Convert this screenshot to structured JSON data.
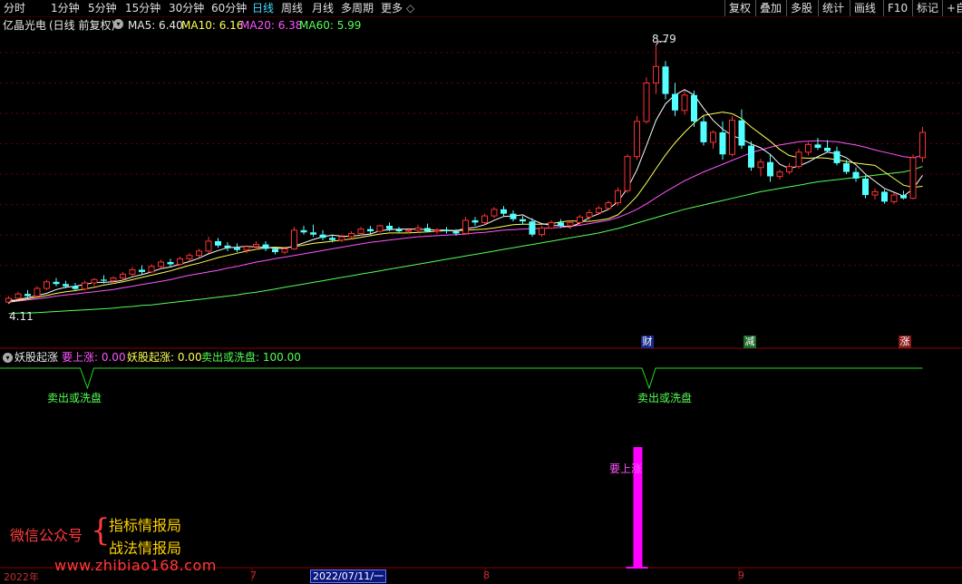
{
  "toolbar": {
    "periods": [
      "分时",
      "1分钟",
      "5分钟",
      "15分钟",
      "30分钟",
      "60分钟",
      "日线",
      "周线",
      "月线",
      "多周期",
      "更多"
    ],
    "active_period": "日线",
    "more_arrow": "◇",
    "right_items": [
      "复权",
      "叠加",
      "多股",
      "统计",
      "画线",
      "F10",
      "标记"
    ],
    "corner": "+自"
  },
  "main_header": {
    "stock_name": "亿晶光电",
    "mode": "(日线 前复权)",
    "ma5_label": "MA5: 6.40",
    "ma10_label": "MA10: 6.16",
    "ma20_label": "MA20: 6.38",
    "ma60_label": "MA60: 5.99"
  },
  "indicator_header": {
    "name": "妖股起涨",
    "l1": "要上涨: 0.00",
    "l2": "妖股起涨: 0.00",
    "l3": "卖出或洗盘: 100.00"
  },
  "annotations": {
    "high": "8.79",
    "low": "4.11",
    "sell1": "卖出或洗盘",
    "sell2": "卖出或洗盘",
    "rise": "要上涨"
  },
  "events": [
    "财",
    "减",
    "涨"
  ],
  "x_axis": {
    "labels": [
      "2022年",
      "7",
      "8",
      "9"
    ],
    "selected": "2022/07/11/一"
  },
  "watermark": {
    "left": "微信公众号",
    "brace": "{",
    "top": "指标情报局",
    "bottom": "战法情报局",
    "url": "www.zhibiao168.com"
  },
  "colors": {
    "up": "#ff3232",
    "down": "#54ffff",
    "ma5": "#ffffff",
    "ma10": "#ffff55",
    "ma20": "#ff55ff",
    "ma60": "#55ff55",
    "indicator_line": "#22dd22",
    "rise_bar": "#ff00ff",
    "grid": "#6a0000"
  },
  "chart_data": {
    "type": "candlestick",
    "ohlc": [
      [
        4.11,
        4.22,
        4.08,
        4.18
      ],
      [
        4.18,
        4.3,
        4.15,
        4.26
      ],
      [
        4.26,
        4.33,
        4.2,
        4.22
      ],
      [
        4.22,
        4.4,
        4.2,
        4.36
      ],
      [
        4.36,
        4.52,
        4.33,
        4.48
      ],
      [
        4.48,
        4.55,
        4.4,
        4.44
      ],
      [
        4.44,
        4.5,
        4.36,
        4.4
      ],
      [
        4.4,
        4.46,
        4.32,
        4.35
      ],
      [
        4.35,
        4.5,
        4.32,
        4.46
      ],
      [
        4.46,
        4.55,
        4.4,
        4.52
      ],
      [
        4.52,
        4.6,
        4.45,
        4.5
      ],
      [
        4.5,
        4.58,
        4.44,
        4.55
      ],
      [
        4.55,
        4.66,
        4.5,
        4.62
      ],
      [
        4.62,
        4.75,
        4.58,
        4.7
      ],
      [
        4.7,
        4.78,
        4.62,
        4.66
      ],
      [
        4.66,
        4.8,
        4.64,
        4.76
      ],
      [
        4.76,
        4.88,
        4.72,
        4.84
      ],
      [
        4.84,
        4.9,
        4.76,
        4.8
      ],
      [
        4.8,
        4.94,
        4.78,
        4.9
      ],
      [
        4.9,
        5.0,
        4.85,
        4.96
      ],
      [
        4.96,
        5.08,
        4.92,
        5.04
      ],
      [
        5.04,
        5.3,
        5.0,
        5.22
      ],
      [
        5.22,
        5.28,
        5.1,
        5.14
      ],
      [
        5.14,
        5.2,
        5.04,
        5.1
      ],
      [
        5.1,
        5.18,
        5.02,
        5.06
      ],
      [
        5.06,
        5.14,
        5.0,
        5.12
      ],
      [
        5.12,
        5.22,
        5.06,
        5.16
      ],
      [
        5.16,
        5.22,
        5.04,
        5.08
      ],
      [
        5.08,
        5.1,
        4.98,
        5.02
      ],
      [
        5.02,
        5.12,
        4.98,
        5.08
      ],
      [
        5.08,
        5.48,
        5.06,
        5.42
      ],
      [
        5.42,
        5.5,
        5.34,
        5.38
      ],
      [
        5.38,
        5.52,
        5.3,
        5.34
      ],
      [
        5.34,
        5.42,
        5.24,
        5.28
      ],
      [
        5.28,
        5.34,
        5.2,
        5.24
      ],
      [
        5.24,
        5.34,
        5.2,
        5.3
      ],
      [
        5.3,
        5.4,
        5.26,
        5.36
      ],
      [
        5.36,
        5.48,
        5.32,
        5.44
      ],
      [
        5.44,
        5.5,
        5.36,
        5.4
      ],
      [
        5.4,
        5.52,
        5.38,
        5.5
      ],
      [
        5.5,
        5.56,
        5.4,
        5.44
      ],
      [
        5.44,
        5.48,
        5.38,
        5.4
      ],
      [
        5.4,
        5.46,
        5.36,
        5.42
      ],
      [
        5.42,
        5.52,
        5.38,
        5.46
      ],
      [
        5.46,
        5.54,
        5.38,
        5.4
      ],
      [
        5.4,
        5.46,
        5.36,
        5.42
      ],
      [
        5.42,
        5.48,
        5.36,
        5.4
      ],
      [
        5.4,
        5.44,
        5.32,
        5.36
      ],
      [
        5.36,
        5.66,
        5.34,
        5.6
      ],
      [
        5.6,
        5.66,
        5.5,
        5.56
      ],
      [
        5.56,
        5.72,
        5.52,
        5.68
      ],
      [
        5.68,
        5.84,
        5.64,
        5.8
      ],
      [
        5.8,
        5.86,
        5.66,
        5.72
      ],
      [
        5.72,
        5.78,
        5.58,
        5.62
      ],
      [
        5.62,
        5.68,
        5.52,
        5.58
      ],
      [
        5.58,
        5.64,
        5.3,
        5.34
      ],
      [
        5.34,
        5.5,
        5.3,
        5.46
      ],
      [
        5.46,
        5.6,
        5.44,
        5.56
      ],
      [
        5.56,
        5.62,
        5.46,
        5.5
      ],
      [
        5.5,
        5.6,
        5.44,
        5.56
      ],
      [
        5.56,
        5.7,
        5.52,
        5.66
      ],
      [
        5.66,
        5.8,
        5.6,
        5.74
      ],
      [
        5.74,
        5.86,
        5.7,
        5.82
      ],
      [
        5.82,
        5.96,
        5.78,
        5.92
      ],
      [
        5.92,
        6.2,
        5.86,
        6.14
      ],
      [
        6.14,
        6.8,
        6.1,
        6.76
      ],
      [
        6.76,
        7.5,
        6.7,
        7.4
      ],
      [
        7.4,
        8.2,
        7.36,
        8.1
      ],
      [
        8.1,
        8.79,
        7.9,
        8.4
      ],
      [
        8.4,
        8.5,
        7.8,
        7.9
      ],
      [
        7.9,
        8.1,
        7.5,
        7.6
      ],
      [
        7.6,
        7.96,
        7.52,
        7.88
      ],
      [
        7.88,
        7.96,
        7.3,
        7.4
      ],
      [
        7.4,
        7.5,
        6.96,
        7.02
      ],
      [
        7.02,
        7.24,
        6.9,
        7.2
      ],
      [
        7.2,
        7.4,
        6.7,
        6.8
      ],
      [
        6.8,
        7.5,
        6.76,
        7.42
      ],
      [
        7.42,
        7.62,
        6.9,
        6.96
      ],
      [
        6.96,
        7.04,
        6.5,
        6.56
      ],
      [
        6.56,
        6.72,
        6.4,
        6.66
      ],
      [
        6.66,
        6.8,
        6.3,
        6.4
      ],
      [
        6.4,
        6.52,
        6.34,
        6.48
      ],
      [
        6.48,
        6.64,
        6.44,
        6.58
      ],
      [
        6.58,
        6.9,
        6.54,
        6.84
      ],
      [
        6.84,
        7.02,
        6.78,
        6.98
      ],
      [
        6.98,
        7.1,
        6.88,
        6.92
      ],
      [
        6.92,
        7.06,
        6.84,
        6.86
      ],
      [
        6.86,
        6.94,
        6.6,
        6.64
      ],
      [
        6.64,
        6.7,
        6.44,
        6.48
      ],
      [
        6.48,
        6.56,
        6.3,
        6.36
      ],
      [
        6.36,
        6.42,
        6.0,
        6.06
      ],
      [
        6.06,
        6.18,
        5.98,
        6.12
      ],
      [
        6.12,
        6.16,
        5.9,
        5.94
      ],
      [
        5.94,
        6.1,
        5.9,
        6.06
      ],
      [
        6.06,
        6.14,
        5.98,
        6.0
      ],
      [
        6.0,
        6.8,
        5.98,
        6.74
      ],
      [
        6.74,
        7.3,
        6.66,
        7.2
      ]
    ],
    "ma5": [
      4.11,
      4.16,
      4.19,
      4.23,
      4.27,
      4.34,
      4.38,
      4.4,
      4.43,
      4.47,
      4.47,
      4.48,
      4.51,
      4.57,
      4.61,
      4.66,
      4.72,
      4.75,
      4.8,
      4.85,
      4.91,
      4.99,
      5.05,
      5.1,
      5.11,
      5.13,
      5.11,
      5.11,
      5.09,
      5.09,
      5.13,
      5.19,
      5.25,
      5.3,
      5.33,
      5.31,
      5.31,
      5.33,
      5.35,
      5.41,
      5.43,
      5.44,
      5.44,
      5.44,
      5.43,
      5.42,
      5.42,
      5.41,
      5.45,
      5.47,
      5.52,
      5.6,
      5.67,
      5.68,
      5.7,
      5.61,
      5.54,
      5.51,
      5.5,
      5.48,
      5.55,
      5.65,
      5.72,
      5.8,
      5.94,
      6.18,
      6.52,
      6.96,
      7.42,
      7.72,
      7.88,
      7.98,
      7.88,
      7.64,
      7.42,
      7.26,
      7.14,
      7.08,
      6.99,
      6.92,
      6.8,
      6.62,
      6.54,
      6.59,
      6.66,
      6.76,
      6.84,
      6.81,
      6.74,
      6.61,
      6.44,
      6.31,
      6.18,
      6.11,
      6.04,
      6.17,
      6.42
    ],
    "ma10": [
      4.11,
      4.14,
      4.17,
      4.2,
      4.23,
      4.27,
      4.3,
      4.32,
      4.35,
      4.38,
      4.42,
      4.45,
      4.48,
      4.52,
      4.56,
      4.6,
      4.64,
      4.68,
      4.73,
      4.78,
      4.82,
      4.87,
      4.92,
      4.96,
      5.0,
      5.04,
      5.07,
      5.1,
      5.11,
      5.1,
      5.12,
      5.15,
      5.18,
      5.2,
      5.22,
      5.24,
      5.26,
      5.29,
      5.32,
      5.35,
      5.37,
      5.37,
      5.37,
      5.38,
      5.39,
      5.4,
      5.41,
      5.41,
      5.42,
      5.43,
      5.44,
      5.46,
      5.49,
      5.52,
      5.53,
      5.53,
      5.53,
      5.54,
      5.57,
      5.59,
      5.58,
      5.58,
      5.6,
      5.63,
      5.7,
      5.86,
      6.04,
      6.28,
      6.54,
      6.79,
      7.01,
      7.2,
      7.37,
      7.51,
      7.54,
      7.57,
      7.54,
      7.45,
      7.3,
      7.17,
      7.04,
      6.89,
      6.78,
      6.74,
      6.73,
      6.74,
      6.73,
      6.7,
      6.67,
      6.64,
      6.62,
      6.6,
      6.48,
      6.36,
      6.24,
      6.2,
      6.22
    ],
    "ma20": [
      4.11,
      4.13,
      4.15,
      4.17,
      4.19,
      4.22,
      4.24,
      4.26,
      4.28,
      4.3,
      4.32,
      4.34,
      4.37,
      4.4,
      4.43,
      4.46,
      4.49,
      4.52,
      4.56,
      4.6,
      4.63,
      4.66,
      4.69,
      4.73,
      4.76,
      4.8,
      4.84,
      4.87,
      4.9,
      4.93,
      4.96,
      4.99,
      5.02,
      5.05,
      5.08,
      5.11,
      5.14,
      5.17,
      5.2,
      5.22,
      5.24,
      5.26,
      5.28,
      5.3,
      5.31,
      5.32,
      5.33,
      5.34,
      5.35,
      5.37,
      5.38,
      5.4,
      5.42,
      5.43,
      5.44,
      5.45,
      5.45,
      5.46,
      5.47,
      5.49,
      5.51,
      5.54,
      5.57,
      5.6,
      5.65,
      5.72,
      5.8,
      5.9,
      6.01,
      6.12,
      6.22,
      6.32,
      6.4,
      6.48,
      6.55,
      6.62,
      6.69,
      6.76,
      6.83,
      6.88,
      6.93,
      6.97,
      7.0,
      7.03,
      7.04,
      7.05,
      7.04,
      7.03,
      7.0,
      6.97,
      6.93,
      6.88,
      6.84,
      6.8,
      6.76,
      6.74,
      6.78
    ],
    "ma60": [
      3.9,
      3.91,
      3.91,
      3.92,
      3.93,
      3.94,
      3.95,
      3.96,
      3.97,
      3.98,
      3.99,
      4.0,
      4.02,
      4.03,
      4.05,
      4.06,
      4.08,
      4.1,
      4.12,
      4.14,
      4.16,
      4.18,
      4.2,
      4.22,
      4.24,
      4.27,
      4.29,
      4.32,
      4.35,
      4.38,
      4.41,
      4.44,
      4.47,
      4.5,
      4.53,
      4.56,
      4.59,
      4.62,
      4.65,
      4.68,
      4.71,
      4.74,
      4.77,
      4.8,
      4.83,
      4.86,
      4.89,
      4.92,
      4.95,
      4.98,
      5.01,
      5.04,
      5.07,
      5.1,
      5.13,
      5.16,
      5.19,
      5.22,
      5.25,
      5.28,
      5.31,
      5.34,
      5.37,
      5.41,
      5.45,
      5.5,
      5.55,
      5.6,
      5.65,
      5.7,
      5.75,
      5.8,
      5.84,
      5.88,
      5.92,
      5.96,
      6.0,
      6.04,
      6.08,
      6.12,
      6.15,
      6.18,
      6.21,
      6.24,
      6.27,
      6.3,
      6.32,
      6.34,
      6.36,
      6.38,
      6.4,
      6.42,
      6.44,
      6.46,
      6.48,
      6.52,
      6.58
    ],
    "y_range": [
      3.75,
      8.95
    ],
    "indicator": {
      "sell_or_wash": "100 on all days except short dips to 0 at bars 8 and 67",
      "sell_dips": [
        8,
        67
      ],
      "rise_bar_index": 66,
      "rise_value": 100
    }
  }
}
